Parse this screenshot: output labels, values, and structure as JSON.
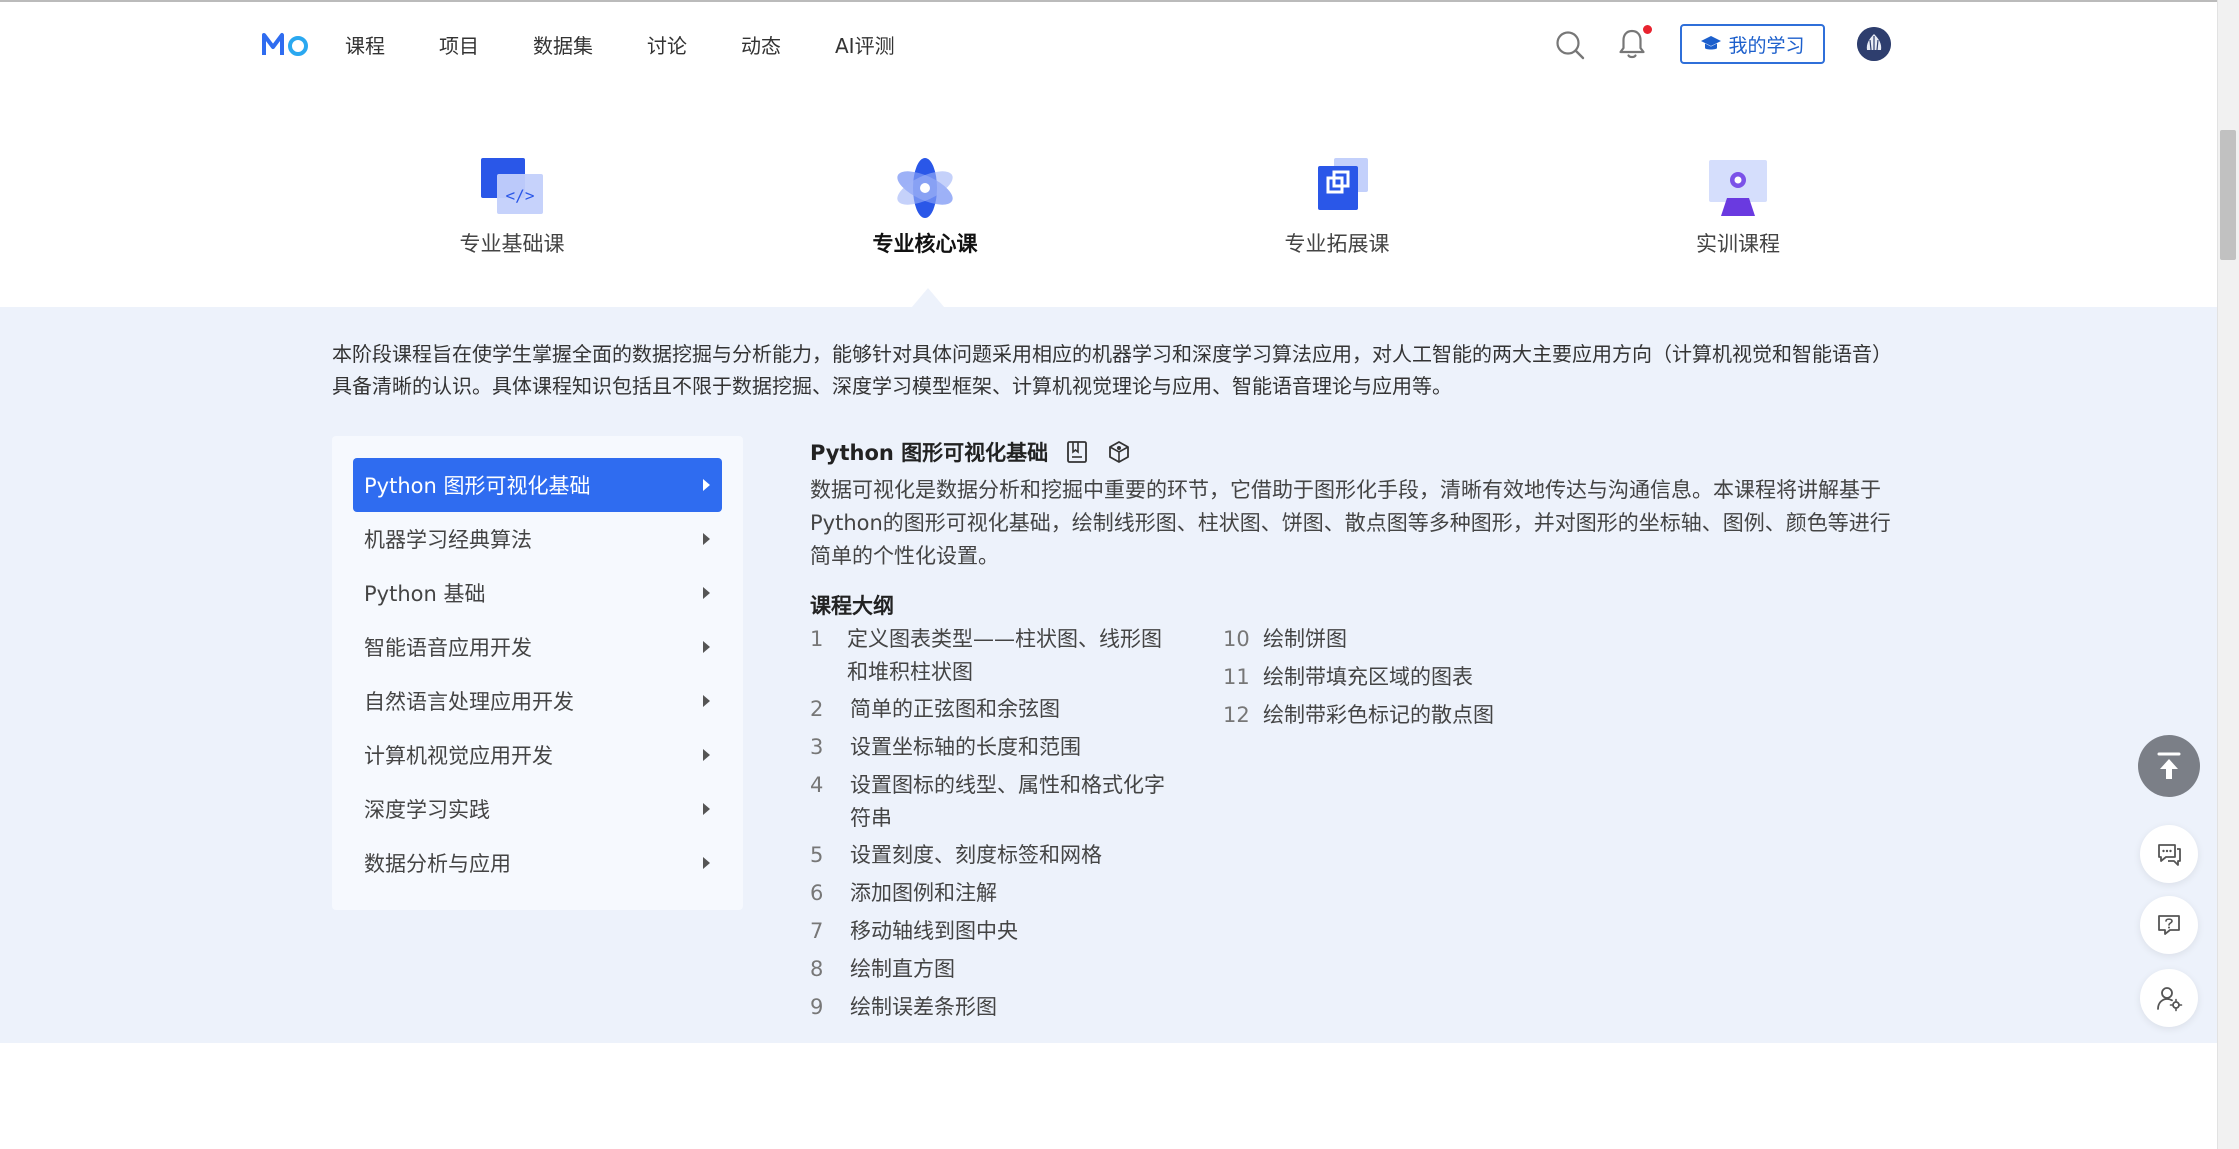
{
  "header": {
    "logo_text": "Mo",
    "nav": [
      "课程",
      "项目",
      "数据集",
      "讨论",
      "动态",
      "AI评测"
    ],
    "my_study_label": "我的学习"
  },
  "tabs": [
    {
      "label": "专业基础课",
      "icon": "code-window-icon",
      "active": false
    },
    {
      "label": "专业核心课",
      "icon": "atom-icon",
      "active": true
    },
    {
      "label": "专业拓展课",
      "icon": "expand-square-icon",
      "active": false
    },
    {
      "label": "实训课程",
      "icon": "monitor-person-icon",
      "active": false
    }
  ],
  "intro": "本阶段课程旨在使学生掌握全面的数据挖掘与分析能力，能够针对具体问题采用相应的机器学习和深度学习算法应用，对人工智能的两大主要应用方向（计算机视觉和智能语音）具备清晰的认识。具体课程知识包括且不限于数据挖掘、深度学习模型框架、计算机视觉理论与应用、智能语音理论与应用等。",
  "sidebar": {
    "items": [
      {
        "label": "Python 图形可视化基础",
        "active": true
      },
      {
        "label": "机器学习经典算法",
        "active": false
      },
      {
        "label": "Python 基础",
        "active": false
      },
      {
        "label": "智能语音应用开发",
        "active": false
      },
      {
        "label": "自然语言处理应用开发",
        "active": false
      },
      {
        "label": "计算机视觉应用开发",
        "active": false
      },
      {
        "label": "深度学习实践",
        "active": false
      },
      {
        "label": "数据分析与应用",
        "active": false
      }
    ]
  },
  "course": {
    "title": "Python 图形可视化基础",
    "description": "数据可视化是数据分析和挖掘中重要的环节，它借助于图形化手段，清晰有效地传达与沟通信息。本课程将讲解基于Python的图形可视化基础，绘制线形图、柱状图、饼图、散点图等多种图形，并对图形的坐标轴、图例、颜色等进行简单的个性化设置。",
    "outline_heading": "课程大纲",
    "outline": [
      {
        "num": "1",
        "text": "定义图表类型——柱状图、线形图和堆积柱状图"
      },
      {
        "num": "2",
        "text": "简单的正弦图和余弦图"
      },
      {
        "num": "3",
        "text": "设置坐标轴的长度和范围"
      },
      {
        "num": "4",
        "text": "设置图标的线型、属性和格式化字符串"
      },
      {
        "num": "5",
        "text": "设置刻度、刻度标签和网格"
      },
      {
        "num": "6",
        "text": "添加图例和注解"
      },
      {
        "num": "7",
        "text": "移动轴线到图中央"
      },
      {
        "num": "8",
        "text": "绘制直方图"
      },
      {
        "num": "9",
        "text": "绘制误差条形图"
      },
      {
        "num": "10",
        "text": "绘制饼图"
      },
      {
        "num": "11",
        "text": "绘制带填充区域的图表"
      },
      {
        "num": "12",
        "text": "绘制带彩色标记的散点图"
      }
    ]
  },
  "colors": {
    "accent": "#2f6cf0",
    "band": "#edf2fb",
    "badge": "#e8232f"
  }
}
